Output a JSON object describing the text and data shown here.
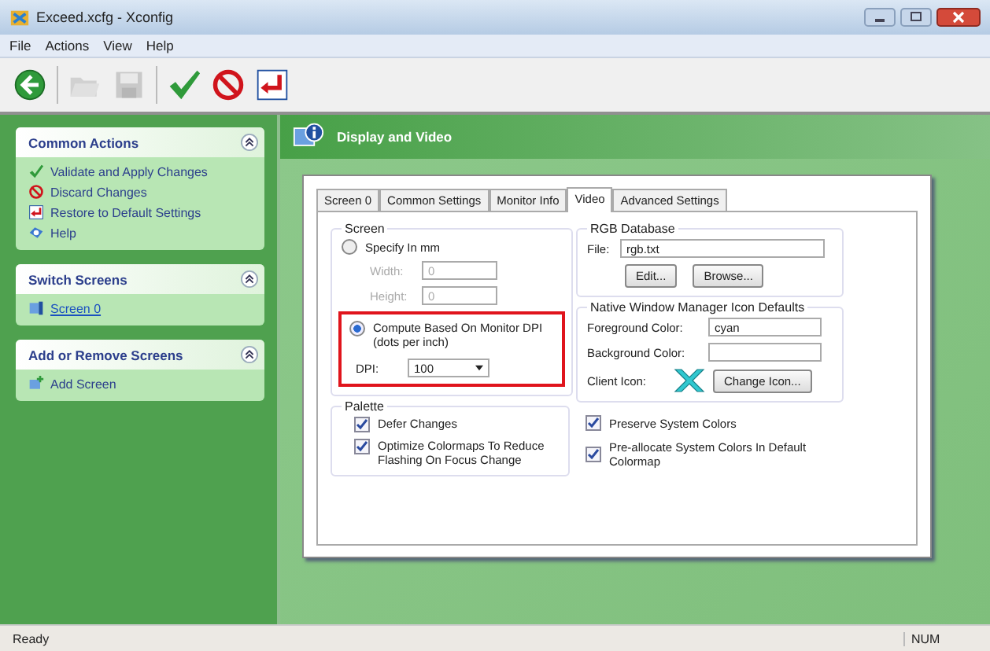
{
  "window": {
    "title": "Exceed.xcfg - Xconfig"
  },
  "menu": [
    "File",
    "Actions",
    "View",
    "Help"
  ],
  "toolbar": [
    {
      "kind": "back",
      "disabled": false
    },
    {
      "kind": "open",
      "disabled": true
    },
    {
      "kind": "save",
      "disabled": true
    },
    {
      "kind": "apply",
      "disabled": false
    },
    {
      "kind": "discard",
      "disabled": false
    },
    {
      "kind": "restore",
      "disabled": false
    }
  ],
  "sidebar": {
    "panels": [
      {
        "title": "Common Actions",
        "items": [
          {
            "label": "Validate and Apply Changes",
            "kind": "apply",
            "link": false
          },
          {
            "label": "Discard Changes",
            "kind": "discard",
            "link": false
          },
          {
            "label": "Restore to Default Settings",
            "kind": "restore",
            "link": false
          },
          {
            "label": "Help",
            "kind": "help",
            "link": false
          }
        ]
      },
      {
        "title": "Switch Screens",
        "items": [
          {
            "label": "Screen 0",
            "kind": "screen",
            "link": true
          }
        ]
      },
      {
        "title": "Add or Remove Screens",
        "items": [
          {
            "label": "Add Screen",
            "kind": "add",
            "link": false
          }
        ]
      }
    ]
  },
  "header": {
    "title": "Display and Video"
  },
  "tabs": [
    {
      "label": "Screen 0",
      "selected": false
    },
    {
      "label": "Common Settings",
      "selected": false
    },
    {
      "label": "Monitor Info",
      "selected": false
    },
    {
      "label": "Video",
      "selected": true
    },
    {
      "label": "Advanced Settings",
      "selected": false
    }
  ],
  "screen": {
    "title": "Screen",
    "specify": {
      "label": "Specify In mm",
      "selected": false
    },
    "fields": [
      {
        "label": "Width:",
        "value": "0",
        "disabled": true
      },
      {
        "label": "Height:",
        "value": "0",
        "disabled": true
      }
    ],
    "compute": {
      "label": "Compute Based On Monitor DPI (dots per inch)",
      "selected": true
    },
    "dpi": {
      "label": "DPI:",
      "value": "100"
    }
  },
  "palette": {
    "title": "Palette",
    "checks": [
      {
        "label": "Defer Changes",
        "checked": true
      },
      {
        "label": "Optimize Colormaps To Reduce Flashing On Focus Change",
        "checked": true
      }
    ]
  },
  "rgb": {
    "title": "RGB Database",
    "file_label": "File:",
    "file": "rgb.txt",
    "buttons": [
      "Edit...",
      "Browse..."
    ]
  },
  "icon_defaults": {
    "title": "Native Window Manager Icon Defaults",
    "foreground_label": "Foreground Color:",
    "foreground": "cyan",
    "background_label": "Background Color:",
    "client_label": "Client Icon:",
    "change_button": "Change Icon..."
  },
  "options": [
    {
      "label": "Preserve System Colors",
      "checked": true
    },
    {
      "label": "Pre-allocate System Colors In Default Colormap",
      "checked": true
    }
  ],
  "status_bar": {
    "text": "Ready",
    "indicator": "NUM"
  }
}
